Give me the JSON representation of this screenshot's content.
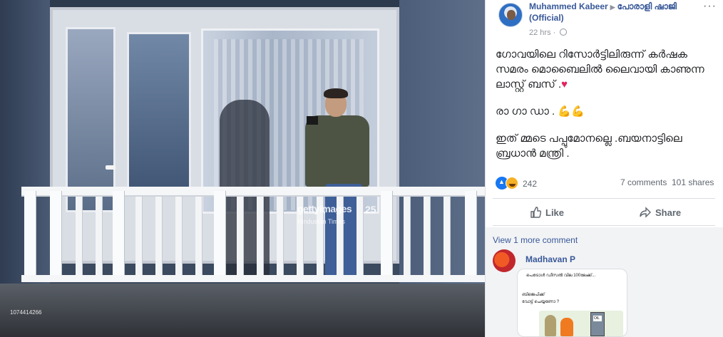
{
  "photo": {
    "watermark": "gettyimages",
    "watermark_badge": "25",
    "watermark_credit": "Hindustan Times",
    "image_id": "1074414266"
  },
  "post": {
    "author": "Muhammed Kabeer",
    "page": "പോരാളി ഷാജി (Official)",
    "timestamp": "22 hrs",
    "more_label": "···",
    "text": {
      "para1": "ഗോവയിലെ റിസോർട്ടിലിരുന്ന് കർഷക സമരം മൊബൈലിൽ ലൈവായി കാണുന്ന ലാസ്റ്റ് ബസ് .",
      "para2": "രാ ഗാ ഡാ . 💪💪",
      "para3": "ഇത് മ്മടെ പപ്പുമോനല്ലെ .ബയനാട്ടിലെ ബ്രധാൻ മന്ത്രി ."
    },
    "reactions": {
      "count": "242",
      "comments": "7 comments",
      "shares": "101 shares"
    },
    "actions": {
      "like": "Like",
      "share": "Share"
    }
  },
  "comments": {
    "view_more": "View 1 more comment",
    "first": {
      "author": "Madhavan P",
      "image_line1": "പെട്രോൾ ഡീസൽ വില 100ലേക്ക്...",
      "image_line2": "ബിജെപിക്ക്",
      "image_line3": "വോട്ട് ചെയ്യണോ ?",
      "image_pump_label": "OIL"
    }
  }
}
